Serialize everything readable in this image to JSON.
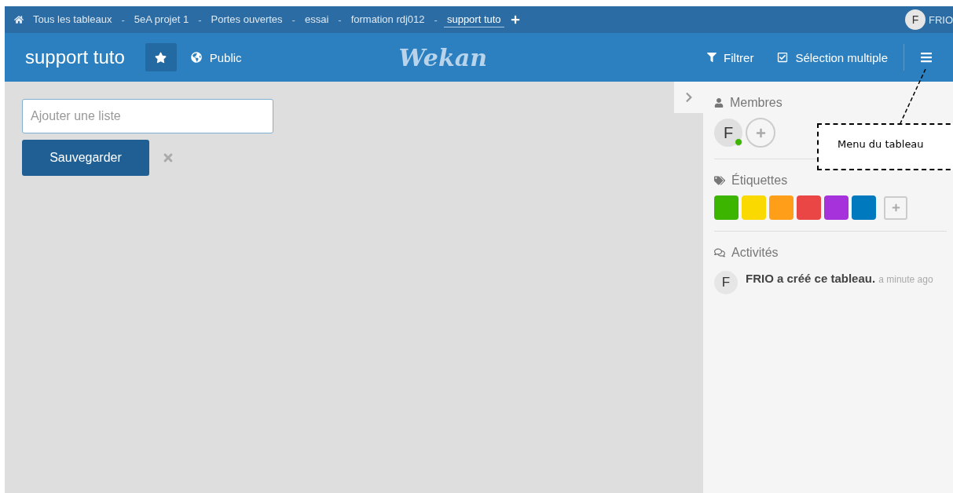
{
  "breadcrumbs": [
    {
      "label": "Tous les tableaux",
      "selected": false
    },
    {
      "label": "5eA projet 1",
      "selected": false
    },
    {
      "label": "Portes ouvertes",
      "selected": false
    },
    {
      "label": "essai",
      "selected": false
    },
    {
      "label": "formation rdj012",
      "selected": false
    },
    {
      "label": "support tuto",
      "selected": true
    }
  ],
  "breadcrumb_separator": "-",
  "user": {
    "initial": "F",
    "name": "FRIO"
  },
  "board": {
    "title": "support tuto",
    "visibility": "Public",
    "logo": "Wekan"
  },
  "header_actions": [
    {
      "kind": "filter",
      "label": "Filtrer"
    },
    {
      "kind": "multiselect",
      "label": "Sélection multiple"
    }
  ],
  "add_list": {
    "placeholder": "Ajouter une liste",
    "button": "Sauvegarder"
  },
  "sidebar": {
    "members_title": "Membres",
    "members": [
      {
        "initial": "F",
        "online": true
      }
    ],
    "labels_title": "Étiquettes",
    "labels": [
      {
        "color": "#3cb500"
      },
      {
        "color": "#fad900"
      },
      {
        "color": "#ff9f19"
      },
      {
        "color": "#eb4646"
      },
      {
        "color": "#a632db"
      },
      {
        "color": "#0079bf"
      }
    ],
    "activities_title": "Activités",
    "activities": [
      {
        "initial": "F",
        "text": "**FRIO a créé ce tableau.**",
        "time": "a minute ago"
      }
    ]
  },
  "callout": {
    "text": "Menu du tableau"
  }
}
